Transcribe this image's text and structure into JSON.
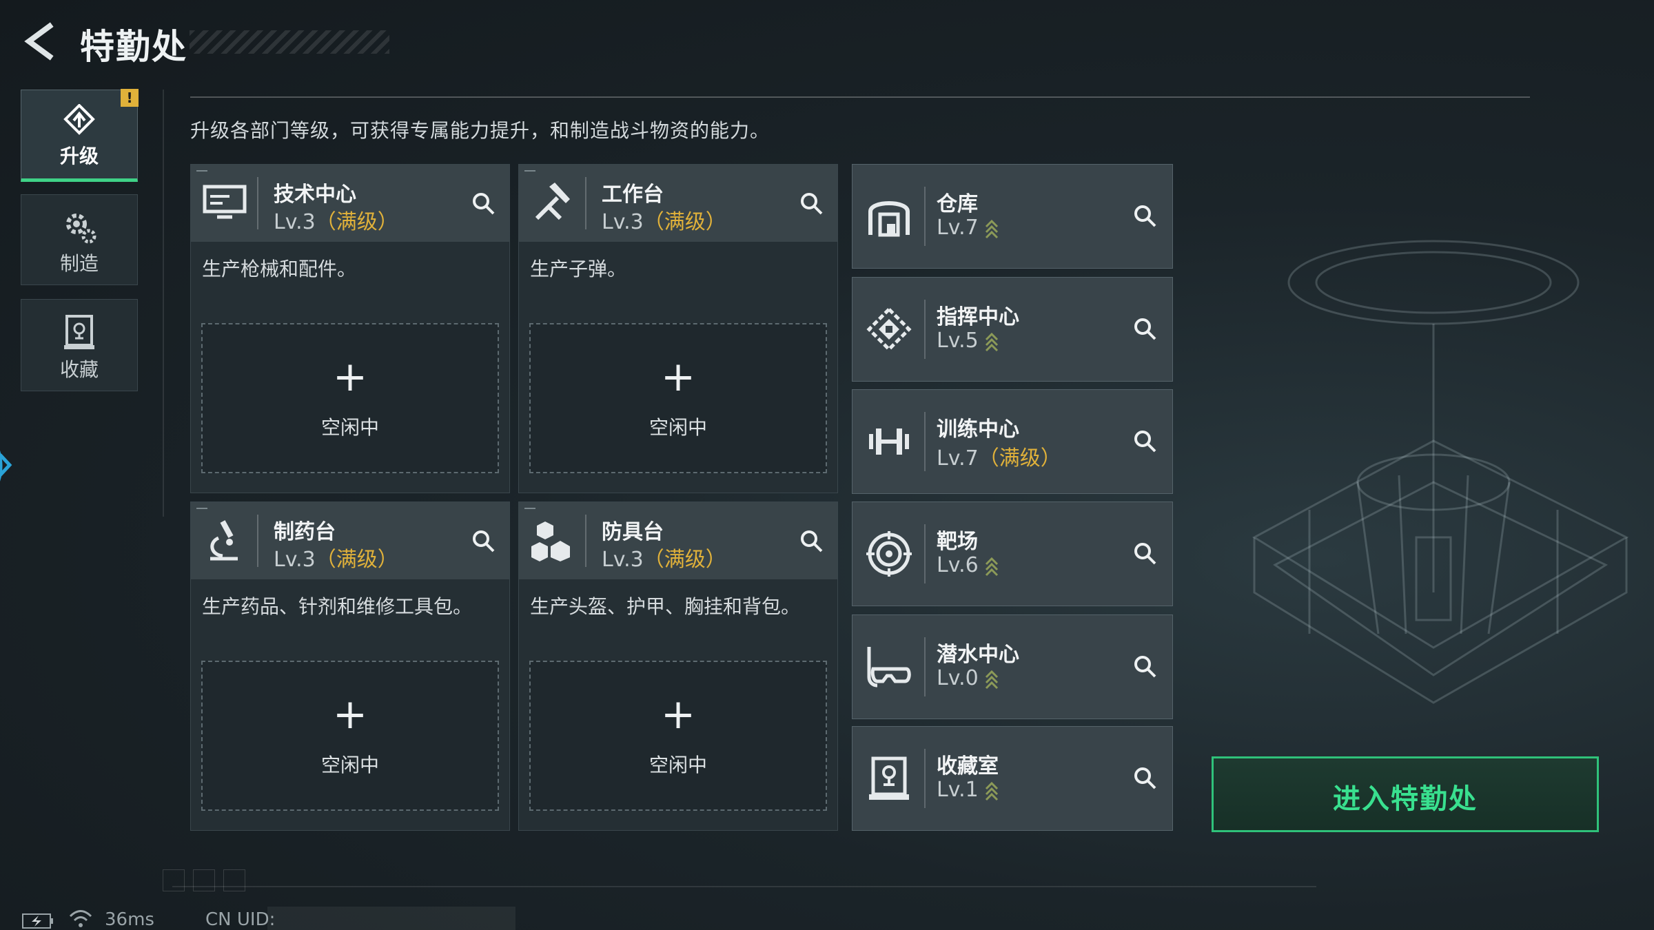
{
  "header": {
    "title": "特勤处"
  },
  "sidebar": {
    "items": [
      {
        "label": "升级",
        "icon": "upgrade-icon",
        "active": true,
        "alert": "!"
      },
      {
        "label": "制造",
        "icon": "gear-icon",
        "active": false
      },
      {
        "label": "收藏",
        "icon": "collection-icon",
        "active": false
      }
    ]
  },
  "main": {
    "description": "升级各部门等级，可获得专属能力提升，和制造战斗物资的能力。",
    "production": [
      {
        "name": "技术中心",
        "level": "Lv.3",
        "max_tag": "（满级）",
        "desc": "生产枪械和配件。",
        "slot_plus": "+",
        "slot_status": "空闲中",
        "icon": "monitor-icon"
      },
      {
        "name": "工作台",
        "level": "Lv.3",
        "max_tag": "（满级）",
        "desc": "生产子弹。",
        "slot_plus": "+",
        "slot_status": "空闲中",
        "icon": "tools-icon"
      },
      {
        "name": "制药台",
        "level": "Lv.3",
        "max_tag": "（满级）",
        "desc": "生产药品、针剂和维修工具包。",
        "slot_plus": "+",
        "slot_status": "空闲中",
        "icon": "microscope-icon"
      },
      {
        "name": "防具台",
        "level": "Lv.3",
        "max_tag": "（满级）",
        "desc": "生产头盔、护甲、胸挂和背包。",
        "slot_plus": "+",
        "slot_status": "空闲中",
        "icon": "armor-boxes-icon"
      }
    ],
    "departments": [
      {
        "name": "仓库",
        "level": "Lv.7",
        "max_tag": "",
        "upgradable": true,
        "icon": "warehouse-icon"
      },
      {
        "name": "指挥中心",
        "level": "Lv.5",
        "max_tag": "",
        "upgradable": true,
        "icon": "command-icon"
      },
      {
        "name": "训练中心",
        "level": "Lv.7",
        "max_tag": "（满级）",
        "upgradable": false,
        "icon": "dumbbell-icon"
      },
      {
        "name": "靶场",
        "level": "Lv.6",
        "max_tag": "",
        "upgradable": true,
        "icon": "target-icon"
      },
      {
        "name": "潜水中心",
        "level": "Lv.0",
        "max_tag": "",
        "upgradable": true,
        "icon": "diving-mask-icon"
      },
      {
        "name": "收藏室",
        "level": "Lv.1",
        "max_tag": "",
        "upgradable": true,
        "icon": "trophy-icon"
      }
    ],
    "enter_button": "进入特勤处"
  },
  "footer": {
    "ping": "36ms",
    "uid_label": "CN UID:"
  },
  "colors": {
    "accent_green": "#39e08f",
    "max_gold": "#e0b13a",
    "panel": "#394449",
    "background": "#1b2429"
  }
}
